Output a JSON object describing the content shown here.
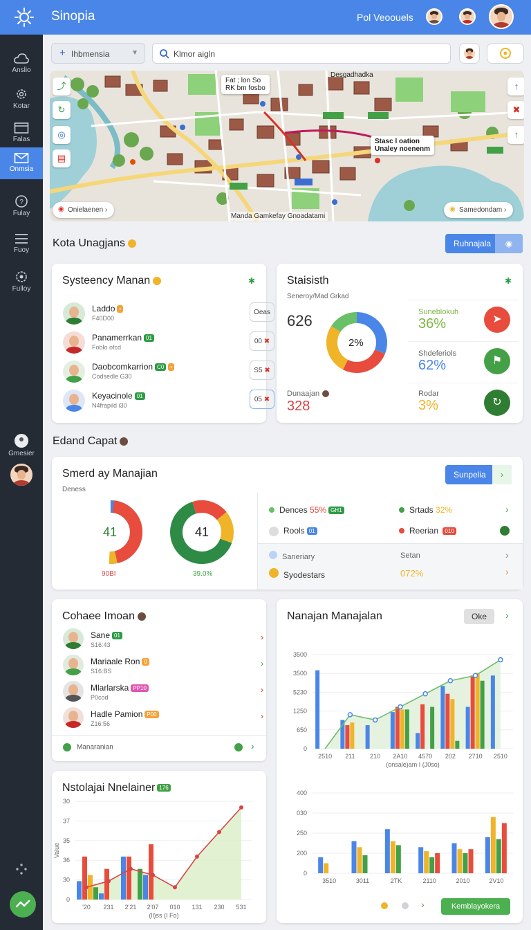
{
  "app": {
    "title": "Sinopia",
    "user_label": "Pol Veoouels"
  },
  "sidebar": {
    "items": [
      {
        "label": "Anslio",
        "icon": "cloud-icon"
      },
      {
        "label": "Kotar",
        "icon": "gear-icon"
      },
      {
        "label": "Falas",
        "icon": "window-icon"
      },
      {
        "label": "Onmsia",
        "icon": "mail-icon",
        "active": true
      },
      {
        "label": "Fulay",
        "icon": "help-icon"
      },
      {
        "label": "Fuoy",
        "icon": "menu-icon"
      },
      {
        "label": "Fulloy",
        "icon": "gear-icon"
      }
    ],
    "bottom_label": "Gmesier"
  },
  "search": {
    "select_value": "Ihbmensia",
    "query": "Klmor aigln"
  },
  "map": {
    "label_top": "Fat ; lon So\nRK bm fosbo",
    "district_top": "Desgadhadka",
    "callout": "Stasc l oation\nUnaley noenenm",
    "pill_left": "Onielaenen",
    "pill_right": "Samedondam",
    "caption": "Manda Gamkefay Gnoadatami"
  },
  "section1": {
    "title": "Kota Unagjans",
    "button_label": "Ruhnajala"
  },
  "people_card": {
    "title": "Systeency Manan",
    "people": [
      {
        "name": "Laddo",
        "sub": "F40D00",
        "tag": "",
        "tag_color": "#f4a23a",
        "btn": "Oeas"
      },
      {
        "name": "Panamerrkan",
        "sub": "Foblo ofcd",
        "tag": "01",
        "tag_color": "#2e9b45",
        "btn": "00"
      },
      {
        "name": "Daobcomkarrion",
        "sub": "Codsedle G30",
        "tag": "C0",
        "tag_color": "#2e9b45",
        "btn": "S5"
      },
      {
        "name": "Keyacinole",
        "sub": "N4frapild i30",
        "tag": "01",
        "tag_color": "#2e9b45",
        "btn": "05"
      }
    ]
  },
  "stats_card": {
    "title": "Staisisth",
    "subtitle": "Seneroy/Mad Grkad",
    "big_value": "626",
    "donut_label": "2%",
    "bottom_label": "Dunaajan",
    "bottom_value": "328",
    "items": [
      {
        "label": "Suneblokuh",
        "value": "36%",
        "color": "#7cb342",
        "icon": "arrow-up-icon",
        "circle": "#e84c3d"
      },
      {
        "label": "Shdeferiols",
        "value": "62%",
        "color": "#4a86e8",
        "icon": "flag-icon",
        "circle": "#43a047"
      },
      {
        "label": "Rodar",
        "value": "3%",
        "color": "#f0b429",
        "icon": "refresh-icon",
        "circle": "#2e7d32"
      }
    ]
  },
  "section2": {
    "title": "Edand Capat"
  },
  "donut_card": {
    "title": "Smerd ay Manajian",
    "subtitle": "Deness",
    "button_label": "Sunpelia",
    "donut1": {
      "label": "41",
      "caption": "90BI"
    },
    "donut2": {
      "label": "41",
      "caption": "39.0%"
    },
    "legend": [
      {
        "label": "Dences",
        "value": "55%",
        "tag": "GH1",
        "color": "#43a047",
        "value_color": "#e84c3d"
      },
      {
        "label": "Srtads",
        "value": "32%",
        "color": "#43a047",
        "value_color": "#f0b429"
      },
      {
        "label": "Rools",
        "tag": "01",
        "icon": "badge-icon"
      },
      {
        "label": "Reerian",
        "tag": "010",
        "color": "#e84c3d"
      }
    ],
    "rows": [
      {
        "label": "Saneriary",
        "value": "Setan"
      },
      {
        "label": "Syodestars",
        "value": "072%"
      }
    ]
  },
  "list_card": {
    "title": "Cohaee Imoan",
    "items": [
      {
        "name": "Sane",
        "sub": "S16:43",
        "tag": "01",
        "tag_color": "#2e9b45"
      },
      {
        "name": "Mariaale Ron",
        "sub": "S16:BS",
        "tag": "0",
        "tag_color": "#f4a23a"
      },
      {
        "name": "Mlarlarska",
        "sub": "P0cod",
        "tag": "PP10",
        "tag_color": "#e056b0"
      },
      {
        "name": "Hadle Pamion",
        "sub": "Z16:56",
        "tag": "P00",
        "tag_color": "#f4a23a"
      }
    ],
    "footer": "Manaranian"
  },
  "line_card": {
    "title": "Nstolajai Nnelainer",
    "tag": "176"
  },
  "bar_card": {
    "title": "Nanajan Manajalan",
    "button_label": "Oke",
    "xlabel": "(onsale)am I (J0so)",
    "footer_button": "Kemblayokera"
  },
  "chart_data": [
    {
      "type": "line",
      "title": "Nstolajai Nnelainer",
      "categories": [
        "'20",
        "231",
        "2'21",
        "2'07",
        "010",
        "131",
        "230",
        "531"
      ],
      "yticks": [
        "30",
        "37",
        "35",
        "36",
        "30",
        "0"
      ],
      "xlabel": "(ll)ss (I Fo)",
      "ylabel": "Value",
      "series": [
        {
          "values": [
            4,
            6,
            10,
            8,
            4,
            14,
            22,
            30
          ],
          "color": "#d64545"
        }
      ],
      "bars": [
        {
          "values": [
            6,
            2,
            14,
            8
          ],
          "color": "#4a86e8"
        },
        {
          "values": [
            14,
            10,
            14,
            18
          ],
          "color": "#e84c3d"
        },
        {
          "values": [
            8,
            0,
            0,
            0
          ],
          "color": "#f0b429"
        },
        {
          "values": [
            4,
            0,
            10,
            0
          ],
          "color": "#43a047"
        }
      ],
      "ylim": [
        0,
        32
      ]
    },
    {
      "type": "bar",
      "title": "Nanajan Manajalan",
      "categories": [
        "2510",
        "211",
        "210",
        "2A10",
        "4570",
        "202",
        "2710",
        "2510"
      ],
      "yticks": [
        "3500",
        "3500",
        "5230",
        "1250",
        "650",
        "0"
      ],
      "series": [
        {
          "values": [
            3000,
            1100,
            900,
            1400,
            600,
            2400,
            1600,
            2800
          ],
          "color": "#4a86e8"
        },
        {
          "values": [
            0,
            900,
            0,
            1600,
            1700,
            2100,
            2800,
            0
          ],
          "color": "#e84c3d"
        },
        {
          "values": [
            0,
            1000,
            0,
            1500,
            0,
            1900,
            2900,
            0
          ],
          "color": "#f0b429"
        },
        {
          "values": [
            0,
            0,
            0,
            1500,
            1600,
            300,
            2600,
            0
          ],
          "color": "#43a047"
        }
      ],
      "line": [
        0,
        1300,
        1100,
        1600,
        2100,
        2600,
        2800,
        3400
      ],
      "ylim": [
        0,
        3600
      ]
    },
    {
      "type": "bar",
      "categories": [
        "3510",
        "3011",
        "2TK",
        "2110",
        "2010",
        "2V10"
      ],
      "yticks": [
        "400",
        "030",
        "250",
        "200",
        "0"
      ],
      "series": [
        {
          "values": [
            80,
            160,
            220,
            130,
            150,
            180
          ],
          "color": "#4a86e8"
        },
        {
          "values": [
            50,
            130,
            160,
            110,
            120,
            280
          ],
          "color": "#f0b429"
        },
        {
          "values": [
            0,
            90,
            140,
            80,
            100,
            170
          ],
          "color": "#43a047"
        },
        {
          "values": [
            0,
            0,
            0,
            100,
            120,
            250
          ],
          "color": "#e84c3d"
        }
      ],
      "ylim": [
        0,
        400
      ]
    }
  ]
}
